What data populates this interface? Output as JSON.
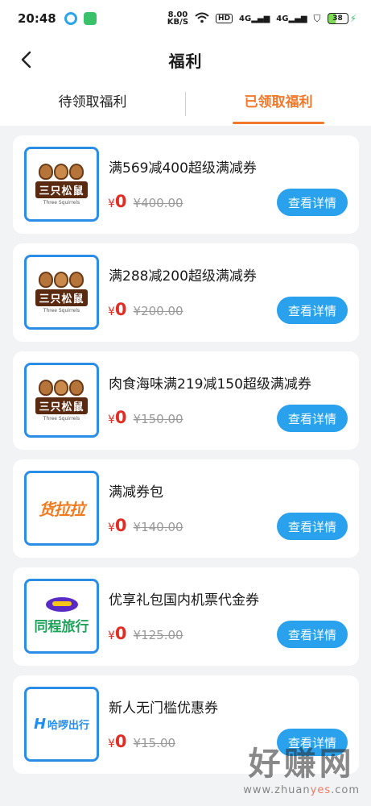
{
  "status_bar": {
    "time": "20:48",
    "net_speed_value": "8.00",
    "net_speed_unit": "KB/S",
    "hd_label": "HD",
    "signal1": "4G",
    "signal2": "4G",
    "battery": "38"
  },
  "nav": {
    "title": "福利"
  },
  "tabs": [
    {
      "label": "待领取福利",
      "active": false
    },
    {
      "label": "已领取福利",
      "active": true
    }
  ],
  "currency": "¥",
  "button_label": "查看详情",
  "cards": [
    {
      "brand": "three-squirrels",
      "brand_name": "三只松鼠",
      "brand_sub": "Three Squirrels",
      "title": "满569减400超级满减券",
      "price": "0",
      "original_price": "¥400.00"
    },
    {
      "brand": "three-squirrels",
      "brand_name": "三只松鼠",
      "brand_sub": "Three Squirrels",
      "title": "满288减200超级满减券",
      "price": "0",
      "original_price": "¥200.00"
    },
    {
      "brand": "three-squirrels",
      "brand_name": "三只松鼠",
      "brand_sub": "Three Squirrels",
      "title": "肉食海味满219减150超级满减券",
      "price": "0",
      "original_price": "¥150.00"
    },
    {
      "brand": "huolala",
      "brand_name": "货拉拉",
      "title": "满减券包",
      "price": "0",
      "original_price": "¥140.00"
    },
    {
      "brand": "tongcheng",
      "brand_name": "同程旅行",
      "title": "优享礼包国内机票代金券",
      "price": "0",
      "original_price": "¥125.00"
    },
    {
      "brand": "hellobike",
      "brand_name": "哈啰出行",
      "title": "新人无门槛优惠券",
      "price": "0",
      "original_price": "¥15.00"
    }
  ],
  "watermark": {
    "text": "好赚网",
    "url_prefix": "www.zhuan",
    "url_highlight": "yes",
    "url_suffix": ".com"
  }
}
